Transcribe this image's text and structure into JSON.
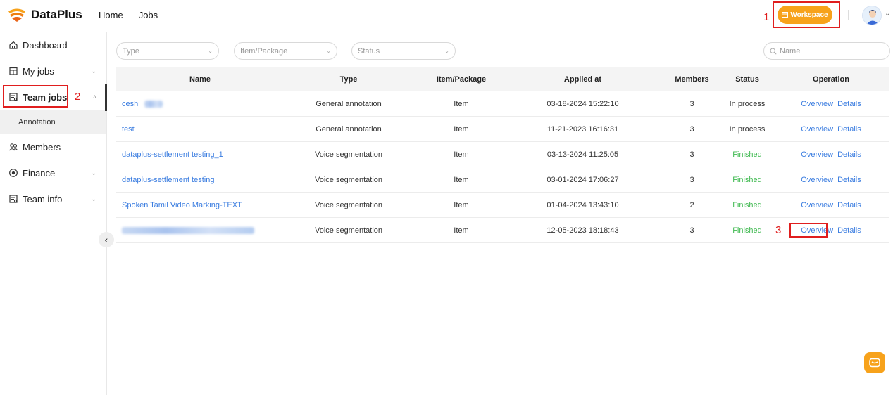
{
  "header": {
    "logo_text": "DataPlus",
    "nav": [
      "Home",
      "Jobs"
    ],
    "workspace_label": "Workspace",
    "brand_color": "#f7a21b"
  },
  "sidebar": {
    "items": [
      {
        "label": "Dashboard",
        "icon": "home-icon",
        "chevron": ""
      },
      {
        "label": "My jobs",
        "icon": "calendar-icon",
        "chevron": "v"
      },
      {
        "label": "Team jobs",
        "icon": "clipboard-icon",
        "chevron": "^"
      },
      {
        "label": "Members",
        "icon": "users-icon",
        "chevron": ""
      },
      {
        "label": "Finance",
        "icon": "finance-icon",
        "chevron": "v"
      },
      {
        "label": "Team info",
        "icon": "info-icon",
        "chevron": "v"
      }
    ],
    "sub_item": "Annotation",
    "collapse_glyph": "‹"
  },
  "filters": {
    "type_placeholder": "Type",
    "item_placeholder": "Item/Package",
    "status_placeholder": "Status",
    "name_placeholder": "Name"
  },
  "table": {
    "headers": [
      "Name",
      "Type",
      "Item/Package",
      "Applied at",
      "Members",
      "Status",
      "Operation"
    ],
    "rows": [
      {
        "name": "ceshi",
        "type": "General annotation",
        "item": "Item",
        "applied": "03-18-2024 15:22:10",
        "members": "3",
        "status": "In process"
      },
      {
        "name": "test",
        "type": "General annotation",
        "item": "Item",
        "applied": "11-21-2023 16:16:31",
        "members": "3",
        "status": "In process"
      },
      {
        "name": "dataplus-settlement testing_1",
        "type": "Voice segmentation",
        "item": "Item",
        "applied": "03-13-2024 11:25:05",
        "members": "3",
        "status": "Finished"
      },
      {
        "name": "dataplus-settlement testing",
        "type": "Voice segmentation",
        "item": "Item",
        "applied": "03-01-2024 17:06:27",
        "members": "3",
        "status": "Finished"
      },
      {
        "name": "Spoken Tamil Video Marking-TEXT",
        "type": "Voice segmentation",
        "item": "Item",
        "applied": "01-04-2024 13:43:10",
        "members": "2",
        "status": "Finished"
      },
      {
        "name": "",
        "type": "Voice segmentation",
        "item": "Item",
        "applied": "12-05-2023 18:18:43",
        "members": "3",
        "status": "Finished"
      }
    ],
    "op_overview": "Overview",
    "op_details": "Details"
  },
  "annotations": {
    "label_1": "1",
    "label_2": "2",
    "label_3": "3",
    "color": "#e01e1e"
  }
}
